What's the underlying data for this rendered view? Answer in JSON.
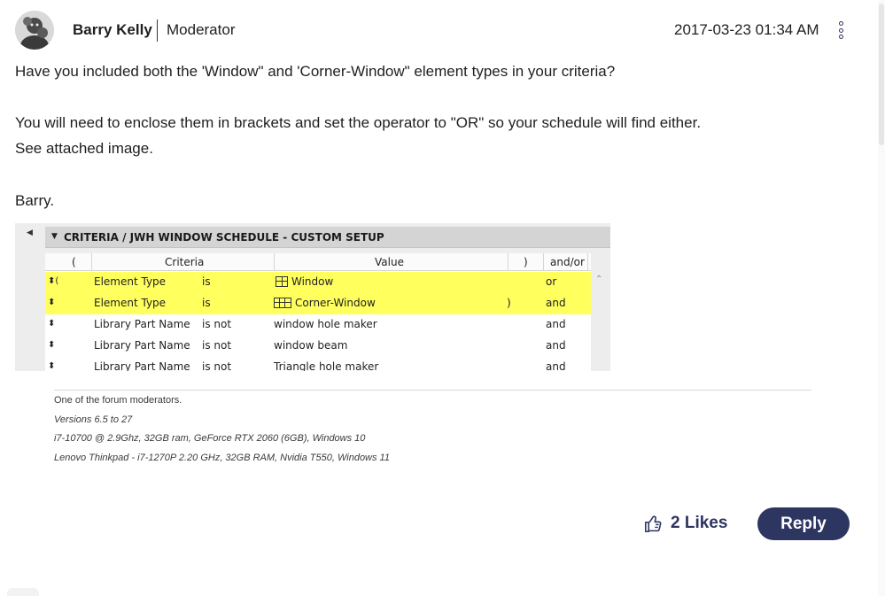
{
  "post": {
    "author": "Barry Kelly",
    "role": "Moderator",
    "timestamp": "2017-03-23 01:34 AM",
    "menu_icon": "kebab-menu-icon",
    "paragraphs": [
      "Have you included both the 'Window\" and 'Corner-Window\" element types in your criteria?",
      "You will need to enclose them in brackets and set the operator to \"OR\" so your schedule will find either.",
      "See attached image.",
      "Barry."
    ]
  },
  "attachment": {
    "title": "CRITERIA / JWH WINDOW SCHEDULE - CUSTOM SETUP",
    "columns": [
      "(",
      "Criteria",
      "Value",
      ")",
      "and/or"
    ],
    "rows": [
      {
        "handle": "⬍(",
        "criteria": "Element Type",
        "op": "is",
        "value_icon": "window-icon",
        "value": "Window",
        "close": "",
        "andor": "or",
        "highlight": true
      },
      {
        "handle": "⬍",
        "criteria": "Element Type",
        "op": "is",
        "value_icon": "corner-window-icon",
        "value": "Corner-Window",
        "close": ")",
        "andor": "and",
        "highlight": true
      },
      {
        "handle": "⬍",
        "criteria": "Library Part Name",
        "op": "is not",
        "value_icon": "",
        "value": "window hole maker",
        "close": "",
        "andor": "and",
        "highlight": false
      },
      {
        "handle": "⬍",
        "criteria": "Library Part Name",
        "op": "is not",
        "value_icon": "",
        "value": "window beam",
        "close": "",
        "andor": "and",
        "highlight": false
      },
      {
        "handle": "⬍",
        "criteria": "Library Part Name",
        "op": "is not",
        "value_icon": "",
        "value": "Triangle hole maker",
        "close": "",
        "andor": "and",
        "highlight": false
      }
    ]
  },
  "signature": [
    "One of the forum moderators.",
    "Versions 6.5 to 27",
    "i7-10700 @ 2.9Ghz, 32GB ram, GeForce RTX 2060 (6GB), Windows 10",
    "Lenovo Thinkpad - i7-1270P 2.20 GHz, 32GB RAM, Nvidia T550, Windows 11"
  ],
  "actions": {
    "likes": "2 Likes",
    "likes_icon": "thumbs-up-icon",
    "reply": "Reply"
  },
  "colors": {
    "accent": "#2d3561",
    "highlight": "#ffff5e"
  }
}
